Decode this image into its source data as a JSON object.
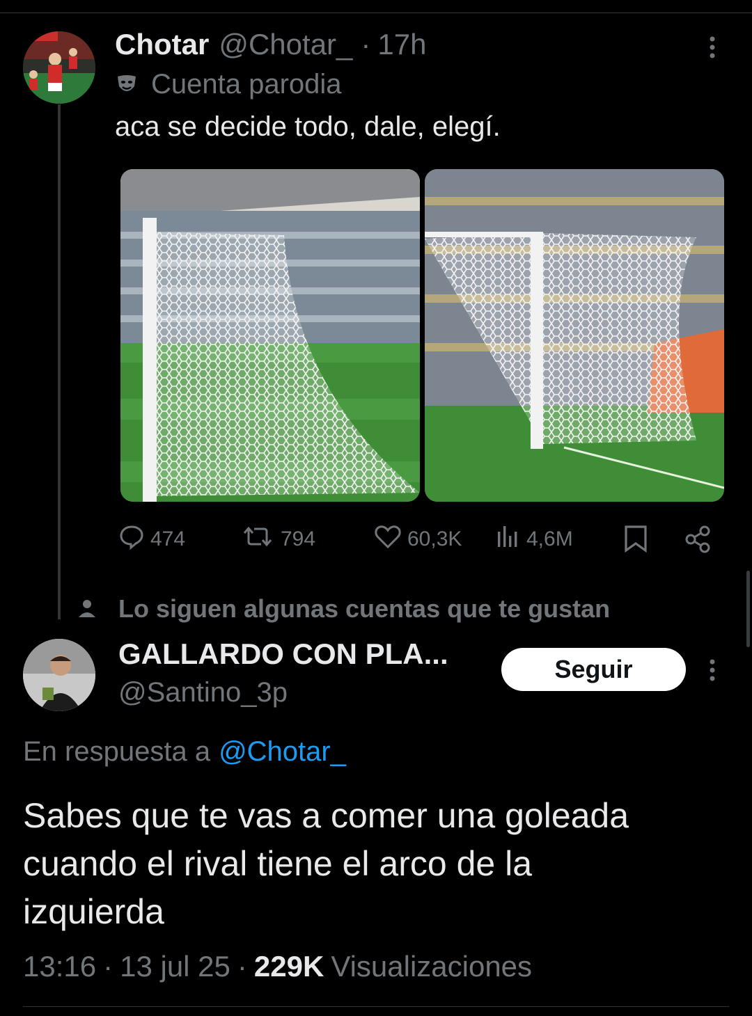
{
  "tweet": {
    "author_name": "Chotar",
    "handle": "@Chotar_",
    "time_sep": "·",
    "time": "17h",
    "parody_label": "Cuenta parodia",
    "text": "aca se decide todo, dale, elegí.",
    "actions": {
      "replies": "474",
      "retweets": "794",
      "likes": "60,3K",
      "views": "4,6M"
    }
  },
  "social_context": {
    "text": "Lo siguen algunas cuentas que te gustan"
  },
  "reply": {
    "author_name": "GALLARDO CON PLA...",
    "handle": "@Santino_3p",
    "follow_label": "Seguir",
    "in_reply_prefix": "En respuesta a",
    "in_reply_handle": "@Chotar_",
    "text_line1": "Sabes que te vas a comer una goleada",
    "text_line2": "cuando el rival tiene el arco de la",
    "text_line3": "izquierda",
    "time": "13:16",
    "date": "13 jul 25",
    "sep": "·",
    "views_count": "229K",
    "views_label": "Visualizaciones"
  },
  "colors": {
    "background": "#000000",
    "text": "#e7e9ea",
    "muted": "#71767b",
    "link": "#1d9bf0"
  }
}
